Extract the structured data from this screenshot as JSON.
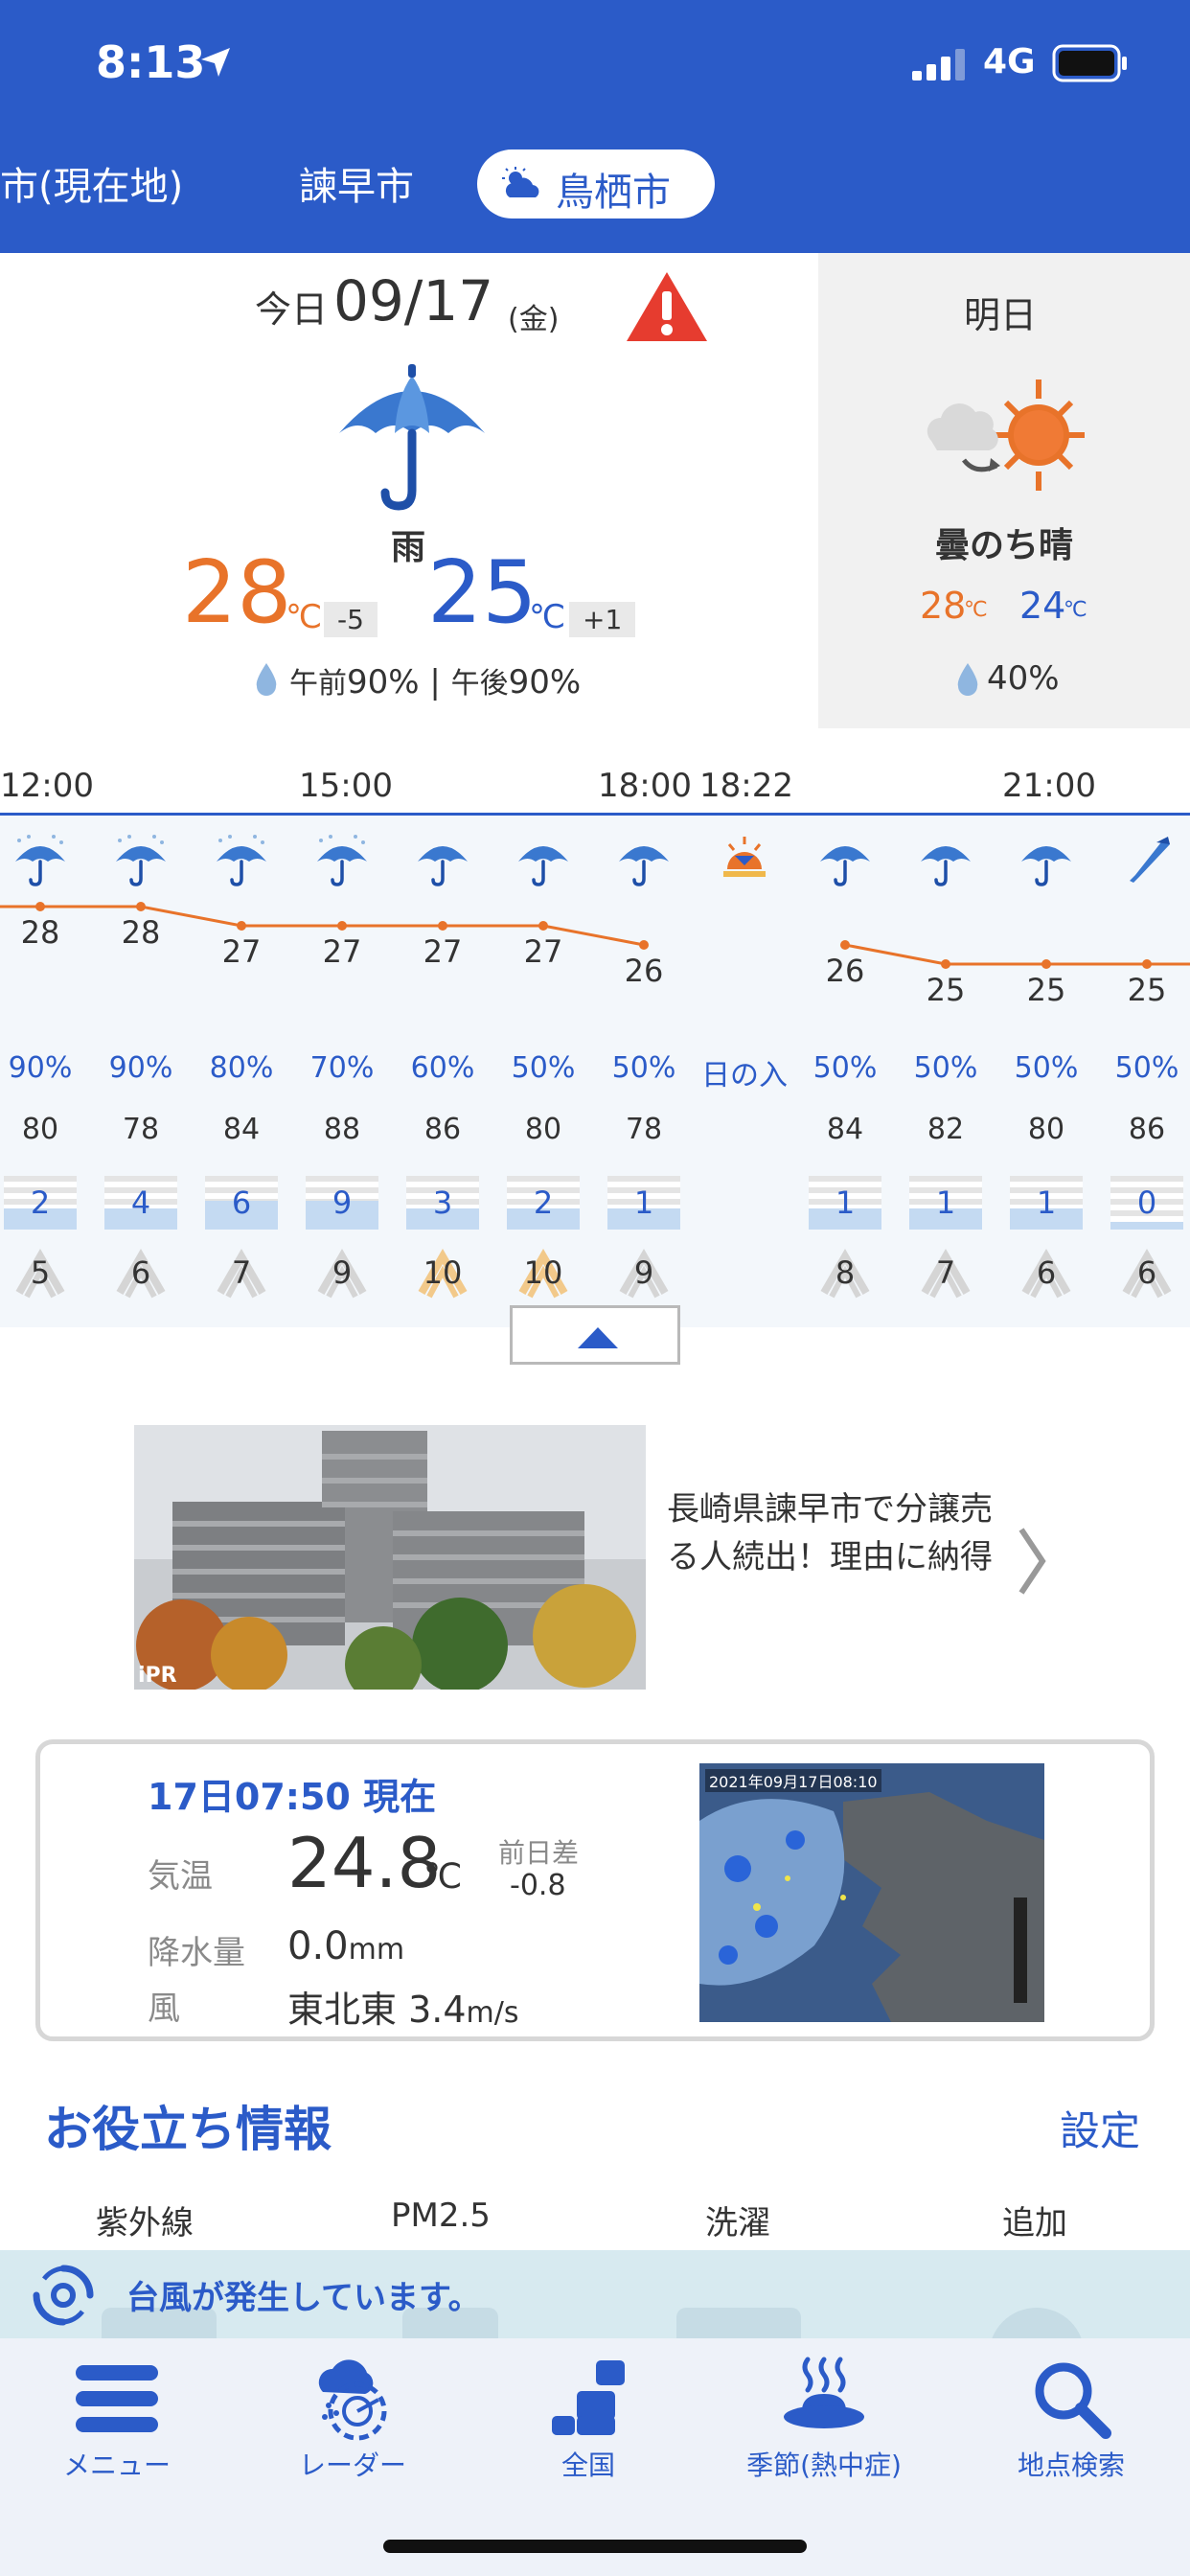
{
  "status_bar": {
    "time": "8:13",
    "network": "4G"
  },
  "location_tabs": [
    {
      "label": "市(現在地)"
    },
    {
      "label": "諫早市"
    },
    {
      "label": "鳥栖市",
      "active": true
    }
  ],
  "today": {
    "date_prefix": "今日",
    "date": "09/17",
    "weekday": "(金)",
    "condition": "雨",
    "high": "28",
    "high_diff": "-5",
    "low": "25",
    "low_diff": "+1",
    "unit": "℃",
    "pop_am_label": "午前",
    "pop_am": "90%",
    "pop_sep": "|",
    "pop_pm_label": "午後",
    "pop_pm": "90%",
    "warning_icon": "warning-icon"
  },
  "tomorrow": {
    "label": "明日",
    "condition": "曇のち晴",
    "high": "28",
    "low": "24",
    "unit": "℃",
    "pop": "40%"
  },
  "hourly": {
    "time_labels": [
      "12:00",
      "15:00",
      "18:00",
      "18:22",
      "21:00"
    ],
    "cells": [
      {
        "icon": "umbrella-rain-icon",
        "temp": "28",
        "pop": "90%",
        "humidity": "80",
        "rain": "2",
        "wind": "5"
      },
      {
        "icon": "umbrella-rain-icon",
        "temp": "28",
        "pop": "90%",
        "humidity": "78",
        "rain": "4",
        "wind": "6"
      },
      {
        "icon": "umbrella-rain-icon",
        "temp": "27",
        "pop": "80%",
        "humidity": "84",
        "rain": "6",
        "wind": "7"
      },
      {
        "icon": "umbrella-rain-icon",
        "temp": "27",
        "pop": "70%",
        "humidity": "88",
        "rain": "9",
        "wind": "9"
      },
      {
        "icon": "umbrella-icon",
        "temp": "27",
        "pop": "60%",
        "humidity": "86",
        "rain": "3",
        "wind": "10"
      },
      {
        "icon": "umbrella-icon",
        "temp": "27",
        "pop": "50%",
        "humidity": "80",
        "rain": "2",
        "wind": "10"
      },
      {
        "icon": "umbrella-icon",
        "temp": "26",
        "pop": "50%",
        "humidity": "78",
        "rain": "1",
        "wind": "9"
      },
      {
        "icon": "sunset-icon",
        "pop": "日の入"
      },
      {
        "icon": "umbrella-icon",
        "temp": "26",
        "pop": "50%",
        "humidity": "84",
        "rain": "1",
        "wind": "8"
      },
      {
        "icon": "umbrella-icon",
        "temp": "25",
        "pop": "50%",
        "humidity": "82",
        "rain": "1",
        "wind": "7"
      },
      {
        "icon": "umbrella-icon",
        "temp": "25",
        "pop": "50%",
        "humidity": "80",
        "rain": "1",
        "wind": "6"
      },
      {
        "icon": "closed-umbrella-icon",
        "temp": "25",
        "pop": "50%",
        "humidity": "86",
        "rain": "0",
        "wind": "6"
      }
    ],
    "collapse_icon": "chevron-up-icon"
  },
  "ad": {
    "text": "長崎県諫早市で分譲売る人続出！理由に納得",
    "badge": "iPR"
  },
  "observation": {
    "timestamp": "17日07:50 現在",
    "temp_label": "気温",
    "temp": "24.8",
    "temp_unit": "℃",
    "diff_label": "前日差",
    "diff": "-0.8",
    "precip_label": "降水量",
    "precip": "0.0",
    "precip_unit": "mm",
    "wind_label": "風",
    "wind": "東北東 3.4",
    "wind_unit": "m/s",
    "radar_timestamp": "2021年09月17日08:10"
  },
  "info": {
    "title": "お役立ち情報",
    "settings": "設定",
    "items": [
      "紫外線",
      "PM2.5",
      "洗濯",
      "追加"
    ]
  },
  "typhoon_banner": "台風が発生しています。",
  "bottom_nav": [
    {
      "label": "メニュー",
      "icon": "menu-icon"
    },
    {
      "label": "レーダー",
      "icon": "radar-icon"
    },
    {
      "label": "全国",
      "icon": "nationwide-icon"
    },
    {
      "label": "季節(熱中症)",
      "icon": "heatstroke-icon"
    },
    {
      "label": "地点検索",
      "icon": "search-icon"
    }
  ],
  "colors": {
    "brand": "#2b5bc8",
    "orange": "#e8732a",
    "warning": "#e63c2f"
  }
}
